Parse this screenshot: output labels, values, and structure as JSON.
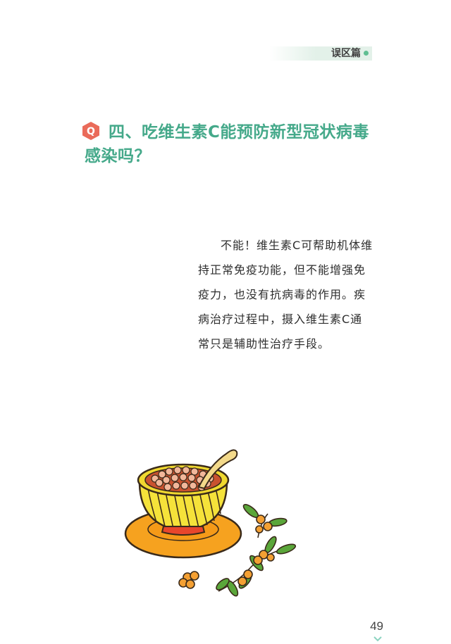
{
  "header": {
    "section_label": "误区篇"
  },
  "question": {
    "badge_letter": "Q",
    "title": "四、吃维生素C能预防新型冠状病毒感染吗？"
  },
  "answer": {
    "text": "不能！维生素C可帮助机体维持正常免疫功能，但不能增强免疫力，也没有抗病毒的作用。疾病治疗过程中，摄入维生素C通常只是辅助性治疗手段。"
  },
  "footer": {
    "page_number": "49"
  },
  "colors": {
    "accent_green": "#45a98a",
    "badge_red": "#ea6b5a",
    "bowl_yellow": "#f5e23a",
    "plate_orange": "#f6a21f",
    "berry_orange": "#f4a033",
    "leaf_green": "#5aa63a"
  },
  "icons": {
    "question_badge": "q-hexagon-icon",
    "illustration": "vitamin-c-bowl-illustration",
    "next_page": "chevron-down-icon"
  }
}
